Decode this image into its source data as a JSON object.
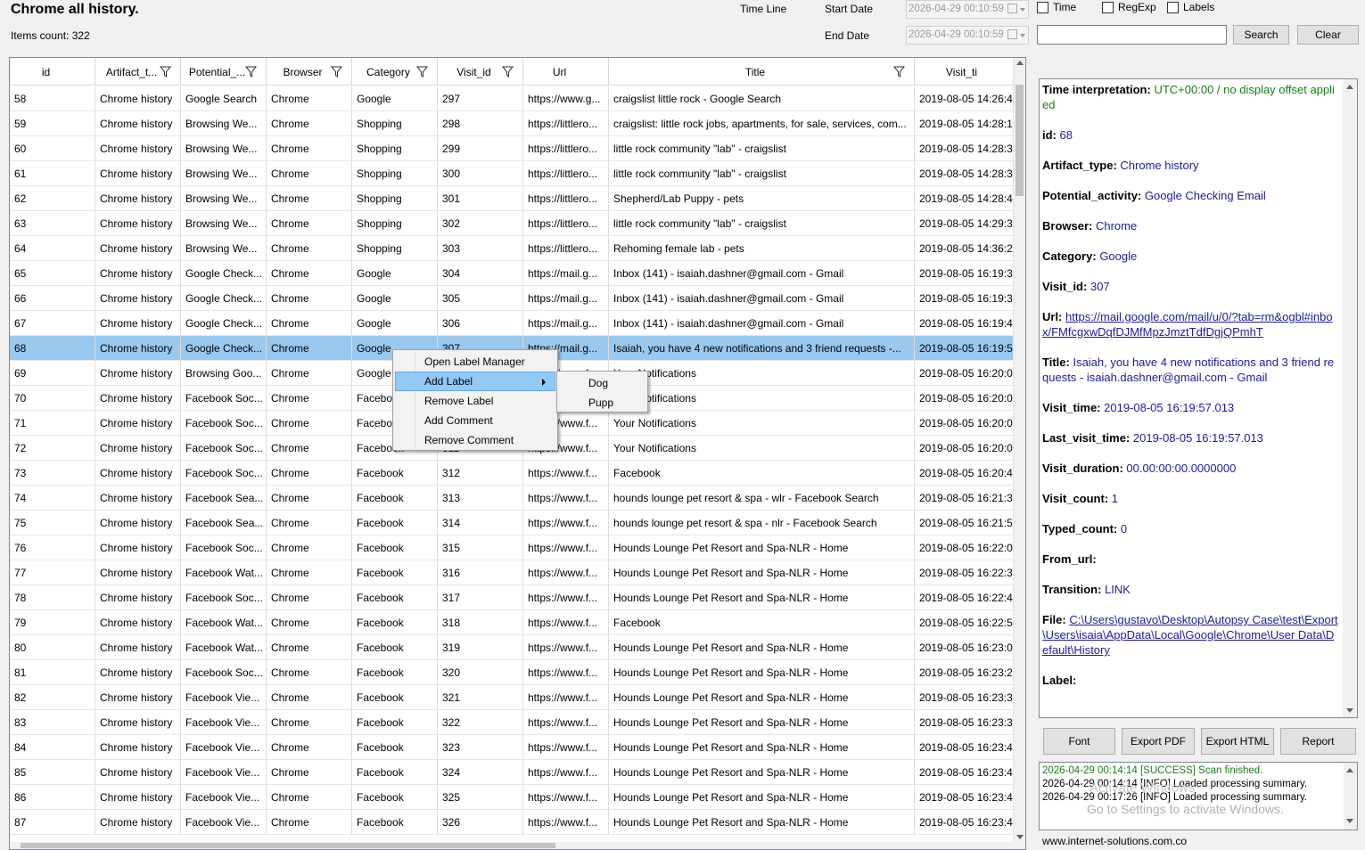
{
  "header": {
    "title": "Chrome all history.",
    "items_count": "Items count: 322",
    "time_line_label": "Time Line",
    "start_date_label": "Start Date",
    "end_date_label": "End Date",
    "start_date_value": "2026-04-29 00:10:59",
    "end_date_value": "2026-04-29 00:10:59",
    "time_checkbox": "Time",
    "regexp_checkbox": "RegExp",
    "labels_checkbox": "Labels",
    "search_button": "Search",
    "clear_button": "Clear",
    "search_value": ""
  },
  "table": {
    "columns": [
      "id",
      "Artifact_t...",
      "Potential_...",
      "Browser",
      "Category",
      "Visit_id",
      "Url",
      "Title",
      "Visit_ti"
    ],
    "rows": [
      [
        "58",
        "Chrome history",
        "Google Search",
        "Chrome",
        "Google",
        "297",
        "https://www.g...",
        "craigslist little rock - Google Search",
        "2019-08-05 14:26:4"
      ],
      [
        "59",
        "Chrome history",
        "Browsing We...",
        "Chrome",
        "Shopping",
        "298",
        "https://littlero...",
        "craigslist: little rock jobs, apartments, for sale, services, com...",
        "2019-08-05 14:28:1"
      ],
      [
        "60",
        "Chrome history",
        "Browsing We...",
        "Chrome",
        "Shopping",
        "299",
        "https://littlero...",
        "little rock community \"lab\" - craigslist",
        "2019-08-05 14:28:3"
      ],
      [
        "61",
        "Chrome history",
        "Browsing We...",
        "Chrome",
        "Shopping",
        "300",
        "https://littlero...",
        "little rock community \"lab\" - craigslist",
        "2019-08-05 14:28:3"
      ],
      [
        "62",
        "Chrome history",
        "Browsing We...",
        "Chrome",
        "Shopping",
        "301",
        "https://littlero...",
        "Shepherd/Lab Puppy - pets",
        "2019-08-05 14:28:4"
      ],
      [
        "63",
        "Chrome history",
        "Browsing We...",
        "Chrome",
        "Shopping",
        "302",
        "https://littlero...",
        "little rock community \"lab\" - craigslist",
        "2019-08-05 14:29:3"
      ],
      [
        "64",
        "Chrome history",
        "Browsing We...",
        "Chrome",
        "Shopping",
        "303",
        "https://littlero...",
        "Rehoming female lab - pets",
        "2019-08-05 14:36:2"
      ],
      [
        "65",
        "Chrome history",
        "Google Check...",
        "Chrome",
        "Google",
        "304",
        "https://mail.g...",
        "Inbox (141) - isaiah.dashner@gmail.com - Gmail",
        "2019-08-05 16:19:3"
      ],
      [
        "66",
        "Chrome history",
        "Google Check...",
        "Chrome",
        "Google",
        "305",
        "https://mail.g...",
        "Inbox (141) - isaiah.dashner@gmail.com - Gmail",
        "2019-08-05 16:19:3"
      ],
      [
        "67",
        "Chrome history",
        "Google Check...",
        "Chrome",
        "Google",
        "306",
        "https://mail.g...",
        "Inbox (141) - isaiah.dashner@gmail.com - Gmail",
        "2019-08-05 16:19:4"
      ],
      [
        "68",
        "Chrome history",
        "Google Check...",
        "Chrome",
        "Google",
        "307",
        "https://mail.g...",
        "Isaiah, you have 4 new notifications and 3 friend requests -...",
        "2019-08-05 16:19:5"
      ],
      [
        "69",
        "Chrome history",
        "Browsing Goo...",
        "Chrome",
        "Google",
        "308",
        "https://www.f...",
        "Your Notifications",
        "2019-08-05 16:20:0"
      ],
      [
        "70",
        "Chrome history",
        "Facebook Soc...",
        "Chrome",
        "Facebook",
        "309",
        "https://www.f...",
        "Your Notifications",
        "2019-08-05 16:20:0"
      ],
      [
        "71",
        "Chrome history",
        "Facebook Soc...",
        "Chrome",
        "Facebook",
        "310",
        "https://www.f...",
        "Your Notifications",
        "2019-08-05 16:20:0"
      ],
      [
        "72",
        "Chrome history",
        "Facebook Soc...",
        "Chrome",
        "Facebook",
        "311",
        "https://www.f...",
        "Your Notifications",
        "2019-08-05 16:20:0"
      ],
      [
        "73",
        "Chrome history",
        "Facebook Soc...",
        "Chrome",
        "Facebook",
        "312",
        "https://www.f...",
        "Facebook",
        "2019-08-05 16:20:4"
      ],
      [
        "74",
        "Chrome history",
        "Facebook Sea...",
        "Chrome",
        "Facebook",
        "313",
        "https://www.f...",
        "hounds lounge pet resort & spa - wlr - Facebook Search",
        "2019-08-05 16:21:3"
      ],
      [
        "75",
        "Chrome history",
        "Facebook Sea...",
        "Chrome",
        "Facebook",
        "314",
        "https://www.f...",
        "hounds lounge pet resort & spa - nlr - Facebook Search",
        "2019-08-05 16:21:5"
      ],
      [
        "76",
        "Chrome history",
        "Facebook Soc...",
        "Chrome",
        "Facebook",
        "315",
        "https://www.f...",
        "Hounds Lounge Pet Resort and Spa-NLR - Home",
        "2019-08-05 16:22:0"
      ],
      [
        "77",
        "Chrome history",
        "Facebook Wat...",
        "Chrome",
        "Facebook",
        "316",
        "https://www.f...",
        "Hounds Lounge Pet Resort and Spa-NLR - Home",
        "2019-08-05 16:22:3"
      ],
      [
        "78",
        "Chrome history",
        "Facebook Soc...",
        "Chrome",
        "Facebook",
        "317",
        "https://www.f...",
        "Hounds Lounge Pet Resort and Spa-NLR - Home",
        "2019-08-05 16:22:4"
      ],
      [
        "79",
        "Chrome history",
        "Facebook Wat...",
        "Chrome",
        "Facebook",
        "318",
        "https://www.f...",
        "Facebook",
        "2019-08-05 16:22:5"
      ],
      [
        "80",
        "Chrome history",
        "Facebook Wat...",
        "Chrome",
        "Facebook",
        "319",
        "https://www.f...",
        "Hounds Lounge Pet Resort and Spa-NLR - Home",
        "2019-08-05 16:23:0"
      ],
      [
        "81",
        "Chrome history",
        "Facebook Soc...",
        "Chrome",
        "Facebook",
        "320",
        "https://www.f...",
        "Hounds Lounge Pet Resort and Spa-NLR - Home",
        "2019-08-05 16:23:2"
      ],
      [
        "82",
        "Chrome history",
        "Facebook Vie...",
        "Chrome",
        "Facebook",
        "321",
        "https://www.f...",
        "Hounds Lounge Pet Resort and Spa-NLR - Home",
        "2019-08-05 16:23:3"
      ],
      [
        "83",
        "Chrome history",
        "Facebook Vie...",
        "Chrome",
        "Facebook",
        "322",
        "https://www.f...",
        "Hounds Lounge Pet Resort and Spa-NLR - Home",
        "2019-08-05 16:23:3"
      ],
      [
        "84",
        "Chrome history",
        "Facebook Vie...",
        "Chrome",
        "Facebook",
        "323",
        "https://www.f...",
        "Hounds Lounge Pet Resort and Spa-NLR - Home",
        "2019-08-05 16:23:4"
      ],
      [
        "85",
        "Chrome history",
        "Facebook Vie...",
        "Chrome",
        "Facebook",
        "324",
        "https://www.f...",
        "Hounds Lounge Pet Resort and Spa-NLR - Home",
        "2019-08-05 16:23:4"
      ],
      [
        "86",
        "Chrome history",
        "Facebook Vie...",
        "Chrome",
        "Facebook",
        "325",
        "https://www.f...",
        "Hounds Lounge Pet Resort and Spa-NLR - Home",
        "2019-08-05 16:23:4"
      ],
      [
        "87",
        "Chrome history",
        "Facebook Vie...",
        "Chrome",
        "Facebook",
        "326",
        "https://www.f...",
        "Hounds Lounge Pet Resort and Spa-NLR - Home",
        "2019-08-05 16:23:4"
      ]
    ],
    "selected_id": "68"
  },
  "context_menu": {
    "items": [
      "Open Label Manager",
      "Add Label",
      "Remove Label",
      "Add Comment",
      "Remove Comment"
    ],
    "submenu": [
      "Dog",
      "Pupp"
    ]
  },
  "detail": {
    "fields": [
      {
        "k": "Time interpretation:",
        "v": "UTC+00:00 / no display offset applied",
        "style": "green"
      },
      {
        "k": "id:",
        "v": "68",
        "style": ""
      },
      {
        "k": "Artifact_type:",
        "v": "Chrome history",
        "style": ""
      },
      {
        "k": "Potential_activity:",
        "v": "Google Checking Email",
        "style": ""
      },
      {
        "k": "Browser:",
        "v": "Chrome",
        "style": ""
      },
      {
        "k": "Category:",
        "v": "Google",
        "style": ""
      },
      {
        "k": "Visit_id:",
        "v": "307",
        "style": ""
      },
      {
        "k": "Url:",
        "v": "https://mail.google.com/mail/u/0/?tab=rm&ogbl#inbox/FMfcgxwDqfDJMfMpzJmztTdfDgjQPmhT",
        "style": "link"
      },
      {
        "k": "Title:",
        "v": "Isaiah, you have 4 new notifications and 3 friend requests - isaiah.dashner@gmail.com - Gmail",
        "style": ""
      },
      {
        "k": "Visit_time:",
        "v": "2019-08-05 16:19:57.013",
        "style": ""
      },
      {
        "k": "Last_visit_time:",
        "v": "2019-08-05 16:19:57.013",
        "style": ""
      },
      {
        "k": "Visit_duration:",
        "v": "00.00:00:00.0000000",
        "style": ""
      },
      {
        "k": "Visit_count:",
        "v": "1",
        "style": ""
      },
      {
        "k": "Typed_count:",
        "v": "0",
        "style": ""
      },
      {
        "k": "From_url:",
        "v": "",
        "style": ""
      },
      {
        "k": "Transition:",
        "v": "LINK",
        "style": ""
      },
      {
        "k": "File:",
        "v": "C:\\Users\\gustavo\\Desktop\\Autopsy Case\\test\\Export\\Users\\isaia\\AppData\\Local\\Google\\Chrome\\User Data\\Default\\History",
        "style": "link"
      },
      {
        "k": "Label:",
        "v": "",
        "style": ""
      }
    ]
  },
  "buttons": {
    "font": "Font",
    "export_pdf": "Export PDF",
    "export_html": "Export HTML",
    "report": "Report"
  },
  "log": {
    "lines": [
      {
        "text": "2026-04-29 00:14:14 [SUCCESS] Scan finished.",
        "style": "green"
      },
      {
        "text": "2026-04-29 00:14:14 [INFO] Loaded processing summary.",
        "style": ""
      },
      {
        "text": "2026-04-29 00:17:26 [INFO] Loaded processing summary.",
        "style": ""
      }
    ]
  },
  "watermark": {
    "line1": "Activate Windows",
    "line2": "Go to Settings to activate Windows."
  },
  "footer": "www.internet-solutions.com.co"
}
